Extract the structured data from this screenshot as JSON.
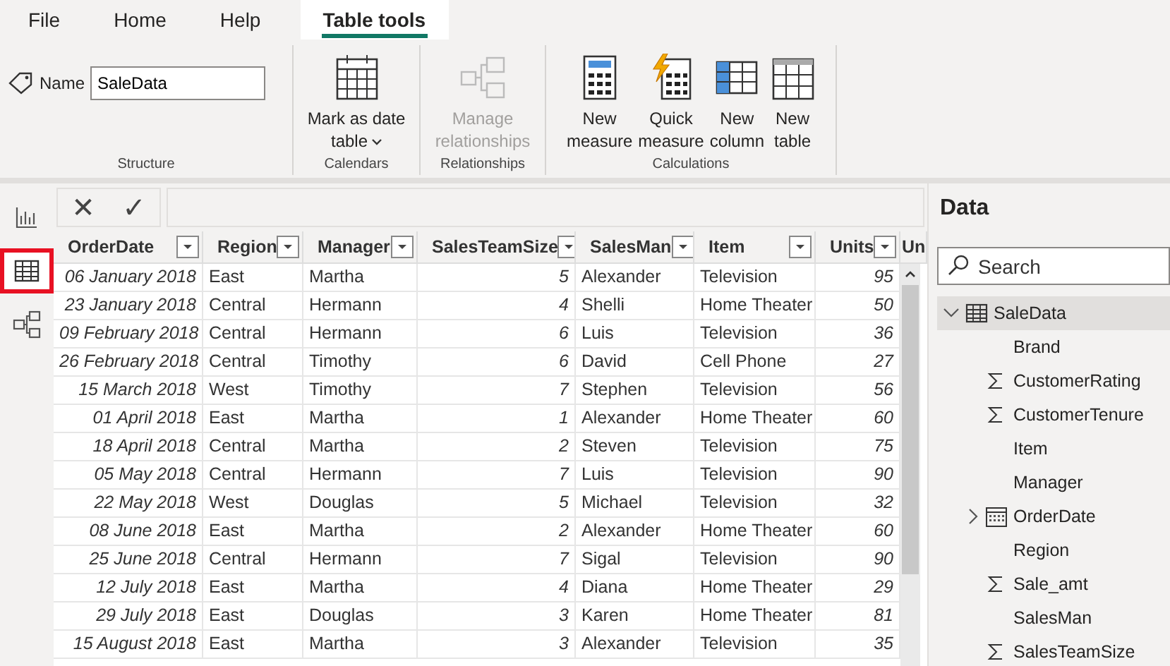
{
  "menu_tabs": [
    {
      "label": "File",
      "selected": false
    },
    {
      "label": "Home",
      "selected": false
    },
    {
      "label": "Help",
      "selected": false
    },
    {
      "label": "Table tools",
      "selected": true
    }
  ],
  "ribbon": {
    "groups": [
      {
        "label": "Structure",
        "kind": "name",
        "name_label": "Name",
        "name_value": "SaleData"
      },
      {
        "label": "Calendars",
        "kind": "buttons",
        "buttons": [
          {
            "kind": "calendar",
            "lines": [
              "Mark as date",
              "table"
            ],
            "dropdown": true,
            "disabled": false
          }
        ]
      },
      {
        "label": "Relationships",
        "kind": "buttons",
        "buttons": [
          {
            "kind": "relationships",
            "lines": [
              "Manage",
              "relationships"
            ],
            "dropdown": false,
            "disabled": true
          }
        ]
      },
      {
        "label": "Calculations",
        "kind": "buttons",
        "buttons": [
          {
            "kind": "calculator",
            "lines": [
              "New",
              "measure"
            ],
            "dropdown": false,
            "disabled": false
          },
          {
            "kind": "quick",
            "lines": [
              "Quick",
              "measure"
            ],
            "dropdown": false,
            "disabled": false
          },
          {
            "kind": "column",
            "lines": [
              "New",
              "column"
            ],
            "dropdown": false,
            "disabled": false
          },
          {
            "kind": "table",
            "lines": [
              "New",
              "table"
            ],
            "dropdown": false,
            "disabled": false
          }
        ]
      }
    ]
  },
  "view_rail": [
    {
      "kind": "report",
      "selected": false
    },
    {
      "kind": "data",
      "selected": true
    },
    {
      "kind": "model",
      "selected": false
    }
  ],
  "formula_bar": {
    "cancel": "✕",
    "commit": "✓"
  },
  "table": {
    "columns": [
      {
        "label": "OrderDate",
        "kind": "date"
      },
      {
        "label": "Region",
        "kind": "text"
      },
      {
        "label": "Manager",
        "kind": "text"
      },
      {
        "label": "SalesTeamSize",
        "kind": "number"
      },
      {
        "label": "SalesMan",
        "kind": "text"
      },
      {
        "label": "Item",
        "kind": "text"
      },
      {
        "label": "Units",
        "kind": "number"
      },
      {
        "label": "Un",
        "kind": "cut"
      }
    ],
    "rows": [
      [
        "06 January 2018",
        "East",
        "Martha",
        "5",
        "Alexander",
        "Television",
        "95"
      ],
      [
        "23 January 2018",
        "Central",
        "Hermann",
        "4",
        "Shelli",
        "Home Theater",
        "50"
      ],
      [
        "09 February 2018",
        "Central",
        "Hermann",
        "6",
        "Luis",
        "Television",
        "36"
      ],
      [
        "26 February 2018",
        "Central",
        "Timothy",
        "6",
        "David",
        "Cell Phone",
        "27"
      ],
      [
        "15 March 2018",
        "West",
        "Timothy",
        "7",
        "Stephen",
        "Television",
        "56"
      ],
      [
        "01 April 2018",
        "East",
        "Martha",
        "1",
        "Alexander",
        "Home Theater",
        "60"
      ],
      [
        "18 April 2018",
        "Central",
        "Martha",
        "2",
        "Steven",
        "Television",
        "75"
      ],
      [
        "05 May 2018",
        "Central",
        "Hermann",
        "7",
        "Luis",
        "Television",
        "90"
      ],
      [
        "22 May 2018",
        "West",
        "Douglas",
        "5",
        "Michael",
        "Television",
        "32"
      ],
      [
        "08 June 2018",
        "East",
        "Martha",
        "2",
        "Alexander",
        "Home Theater",
        "60"
      ],
      [
        "25 June 2018",
        "Central",
        "Hermann",
        "7",
        "Sigal",
        "Television",
        "90"
      ],
      [
        "12 July 2018",
        "East",
        "Martha",
        "4",
        "Diana",
        "Home Theater",
        "29"
      ],
      [
        "29 July 2018",
        "East",
        "Douglas",
        "3",
        "Karen",
        "Home Theater",
        "81"
      ],
      [
        "15 August 2018",
        "East",
        "Martha",
        "3",
        "Alexander",
        "Television",
        "35"
      ]
    ]
  },
  "data_pane": {
    "title": "Data",
    "search": {
      "placeholder": "Search"
    },
    "tree": [
      {
        "label": "SaleData",
        "kind": "table",
        "expanded": true,
        "selected": true,
        "children": [
          {
            "label": "Brand",
            "kind": "text"
          },
          {
            "label": "CustomerRating",
            "kind": "sum"
          },
          {
            "label": "CustomerTenure",
            "kind": "sum"
          },
          {
            "label": "Item",
            "kind": "text"
          },
          {
            "label": "Manager",
            "kind": "text"
          },
          {
            "label": "OrderDate",
            "kind": "date",
            "expanded": false
          },
          {
            "label": "Region",
            "kind": "text"
          },
          {
            "label": "Sale_amt",
            "kind": "sum"
          },
          {
            "label": "SalesMan",
            "kind": "text"
          },
          {
            "label": "SalesTeamSize",
            "kind": "sum"
          }
        ]
      }
    ]
  }
}
